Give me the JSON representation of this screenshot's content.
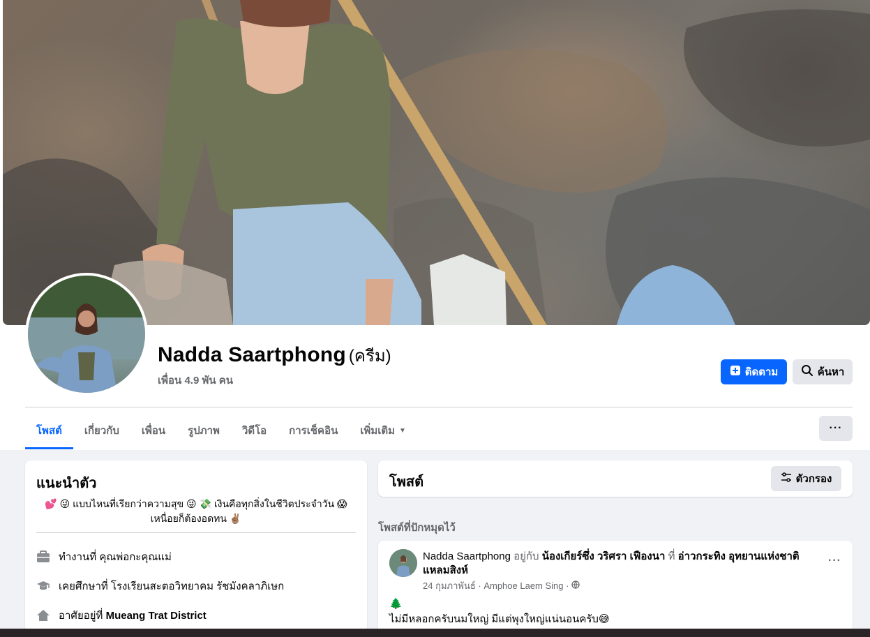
{
  "profile": {
    "name": "Nadda Saartphong",
    "nickname": "(ครีม)",
    "friends": "เพื่อน 4.9 พัน คน"
  },
  "actions": {
    "follow_label": "ติดตาม",
    "search_label": "ค้นหา",
    "more_label": "···"
  },
  "tabs": [
    {
      "label": "โพสต์",
      "active": true
    },
    {
      "label": "เกี่ยวกับ"
    },
    {
      "label": "เพื่อน"
    },
    {
      "label": "รูปภาพ"
    },
    {
      "label": "วิดีโอ"
    },
    {
      "label": "การเช็คอิน"
    },
    {
      "label": "เพิ่มเติม"
    }
  ],
  "intro": {
    "title": "แนะนำตัว",
    "bio_line1": "💕 😜 แบบไหนที่เรียกว่าความสุข 😜 💸 เงินคือทุกสิ่งในชีวิตประจำวัน 😱",
    "bio_line2": "เหนื่อยก็ต้องอดทน ✌🏽",
    "work_prefix": "ทำงานที่ ",
    "work": "คุณพ่อกะคุณแม่",
    "edu_prefix": "เคยศึกษาที่ ",
    "edu": "โรงเรียนสะตอวิทยาคม รัชมังคลาภิเษก",
    "home_prefix": "อาศัยอยู่ที่ ",
    "home": "Mueang Trat District"
  },
  "posts": {
    "title": "โพสต์",
    "filter_label": "ตัวกรอง",
    "pinned_label": "โพสต์ที่ปักหมุดไว้"
  },
  "post": {
    "author": "Nadda Saartphong",
    "with_text": " อยู่กับ ",
    "tagged": "น้องเกียร์ซึ่ง วริศรา เฟืองนา",
    "at_text": " ที่ ",
    "place": "อ่าวกระทิง อุทยานแห่งชาติแหลมสิงห์",
    "date": "24 กุมภาพันธ์ · Amphoe Laem Sing ·",
    "emoji": "🌲",
    "text": "ไม่มีหลอกครับนมใหญ่ มีแต่พุงใหญ่แน่นอนครับ😅",
    "dots": "···"
  },
  "colors": {
    "accent": "#0866ff",
    "secondary_text": "#65676b",
    "button_gray": "#e4e6eb",
    "background": "#f0f2f5"
  }
}
